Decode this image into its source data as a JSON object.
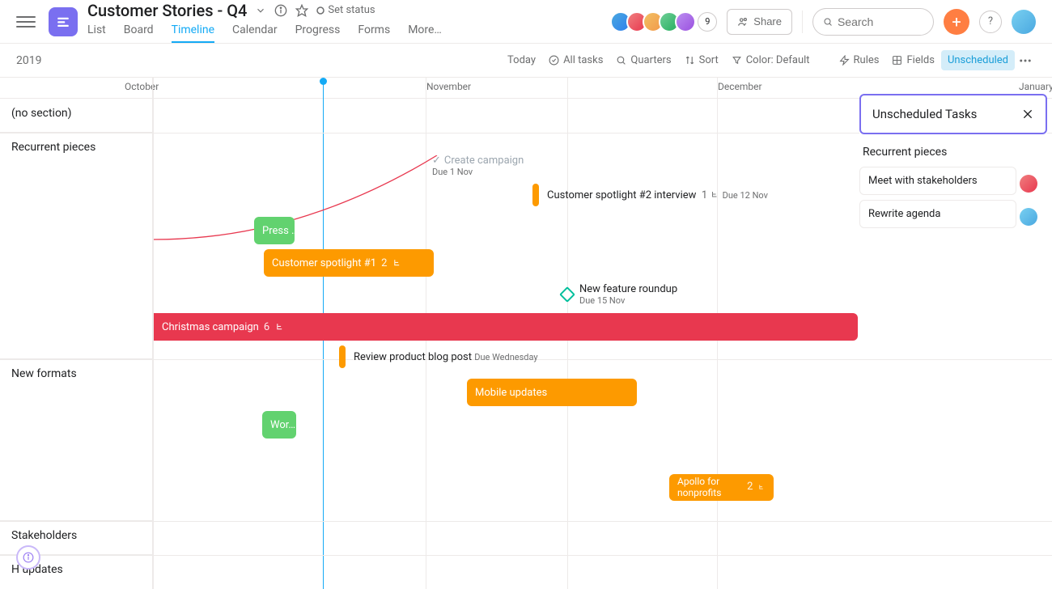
{
  "project": {
    "title": "Customer Stories - Q4",
    "set_status": "Set status"
  },
  "tabs": [
    "List",
    "Board",
    "Timeline",
    "Calendar",
    "Progress",
    "Forms",
    "More…"
  ],
  "active_tab": "Timeline",
  "avatar_extra": "9",
  "share": "Share",
  "search_placeholder": "Search",
  "year": "2019",
  "toolbar": {
    "today": "Today",
    "all_tasks": "All tasks",
    "quarters": "Quarters",
    "sort": "Sort",
    "color": "Color: Default",
    "rules": "Rules",
    "fields": "Fields",
    "unscheduled": "Unscheduled"
  },
  "months": {
    "oct": "October",
    "nov": "November",
    "dec": "December",
    "jan": "January"
  },
  "sections": {
    "none": "(no section)",
    "recurrent": "Recurrent pieces",
    "newformats": "New formats",
    "stakeholders": "Stakeholders",
    "updates": "H     updates"
  },
  "tasks": {
    "create_campaign": {
      "title": "Create campaign",
      "due": "Due 1 Nov"
    },
    "spotlight2": {
      "title": "Customer spotlight #2 interview",
      "count": "1",
      "due": "Due 12 Nov"
    },
    "press": {
      "title": "Press …"
    },
    "spotlight1": {
      "title": "Customer spotlight #1",
      "count": "2"
    },
    "roundup": {
      "title": "New feature roundup",
      "due": "Due 15 Nov"
    },
    "christmas": {
      "title": "Christmas campaign",
      "count": "6"
    },
    "review_blog": {
      "title": "Review product blog post",
      "due": "Due Wednesday"
    },
    "mobile": {
      "title": "Mobile updates"
    },
    "wor": {
      "title": "Wor…"
    },
    "apollo": {
      "title": "Apollo for nonprofits",
      "count": "2"
    }
  },
  "panel": {
    "title": "Unscheduled Tasks",
    "section": "Recurrent pieces",
    "items": [
      "Meet with stakeholders",
      "Rewrite agenda"
    ]
  },
  "colors": {
    "green": "#62d26f",
    "orange": "#fd9a00",
    "red": "#e8384f",
    "teal": "#00bf9c",
    "blue": "#14aaf5",
    "purple": "#7a6ff0"
  },
  "avatar_colors": [
    "#2f80ed",
    "#e8384f",
    "#f2994a",
    "#27ae60",
    "#9b51e0"
  ]
}
